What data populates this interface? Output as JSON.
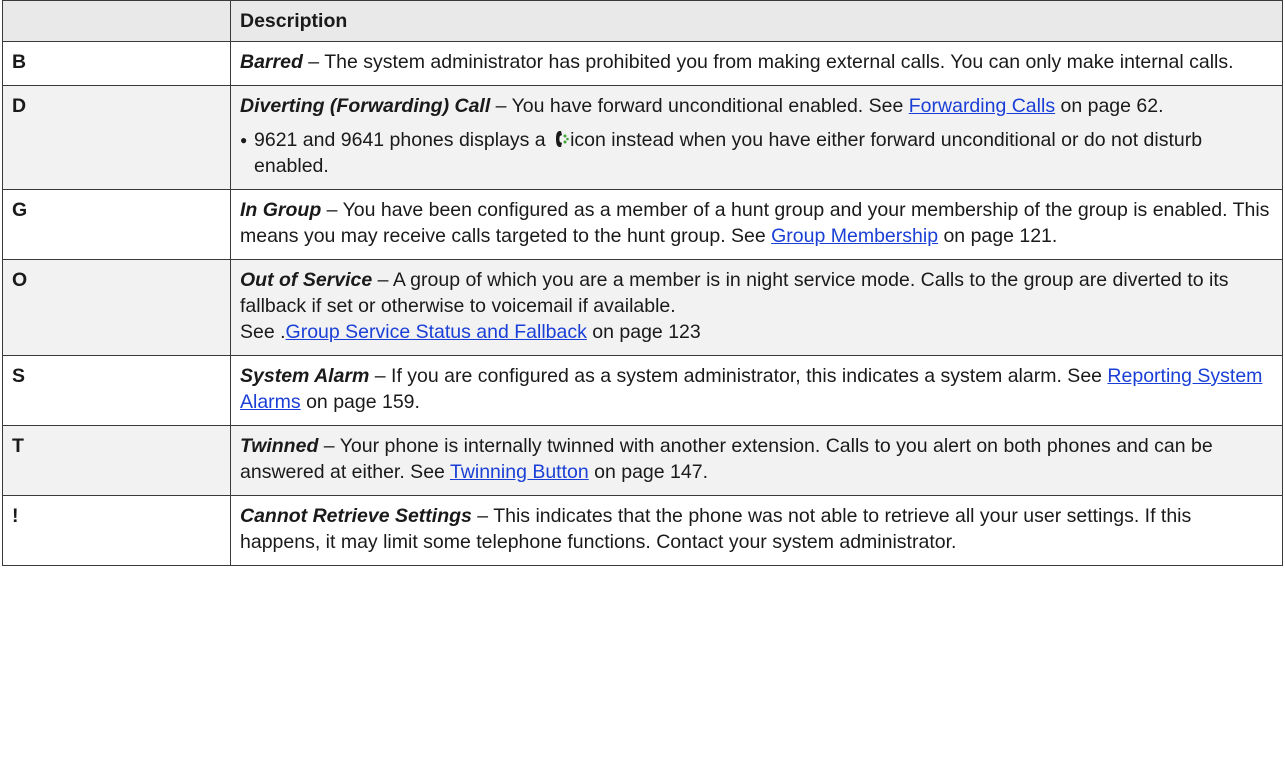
{
  "table": {
    "header": {
      "col1": "",
      "col2": "Description"
    },
    "rows": [
      {
        "code": "B",
        "term": "Barred",
        "text": " – The system administrator has prohibited you from making external calls. You can only make internal calls."
      },
      {
        "code": "D",
        "term": "Diverting (Forwarding) Call",
        "text": " – You have forward unconditional enabled. See ",
        "link": "Forwarding Calls",
        "after": " on page 62.",
        "note_before": "9621 and 9641 phones displays a ",
        "note_icon": "phone-forward-icon",
        "note_after": "icon instead when you have either forward unconditional or do not disturb enabled."
      },
      {
        "code": "G",
        "term": "In Group",
        "text": " – You have been configured as a member of a hunt group and your membership of the group is enabled. This means you may receive calls targeted to the hunt group. See ",
        "link": "Group Membership",
        "after": " on page 121."
      },
      {
        "code": "O",
        "term": "Out of Service",
        "text": " – A group of which you are a member is in night service mode. Calls to the group are diverted to its fallback if set or otherwise to voicemail if available.",
        "text2": "See .",
        "link": "Group Service Status and Fallback",
        "after": " on page 123"
      },
      {
        "code": "S",
        "term": "System Alarm",
        "text": " – If you are configured as a system administrator, this indicates a system alarm. See ",
        "link": "Reporting System Alarms",
        "after": " on page 159."
      },
      {
        "code": "T",
        "term": "Twinned",
        "text": " – Your phone is internally twinned with another extension. Calls to you alert on both phones and can be answered at either. See ",
        "link": "Twinning Button",
        "after": " on page 147."
      },
      {
        "code": "!",
        "term": "Cannot Retrieve Settings",
        "text": " – This indicates that the phone was not able to retrieve all your user settings. If this happens, it may limit some telephone functions. Contact your system administrator."
      }
    ]
  },
  "colors": {
    "link": "#1a3fd6",
    "header_bg": "#e9e9e9",
    "shaded_bg": "#f2f2f2",
    "icon_green": "#3fa535"
  }
}
